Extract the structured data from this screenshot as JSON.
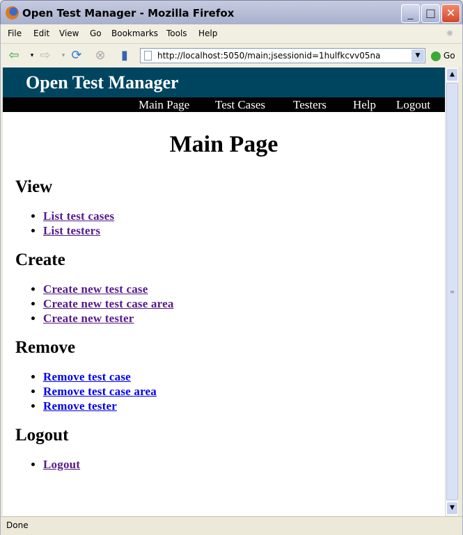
{
  "window": {
    "title": "Open Test Manager - Mozilla Firefox"
  },
  "menu": [
    "File",
    "Edit",
    "View",
    "Go",
    "Bookmarks",
    "Tools",
    "Help"
  ],
  "toolbar": {
    "url": "http://localhost:5050/main;jsessionid=1hulfkcvv05na",
    "go_label": "Go"
  },
  "site": {
    "title": "Open Test Manager",
    "nav": [
      "Main Page",
      "Test Cases",
      "Testers",
      "Help",
      "Logout"
    ]
  },
  "page": {
    "title": "Main Page",
    "sections": [
      {
        "heading": "View",
        "links": [
          "List test cases",
          "List testers"
        ],
        "visited": true
      },
      {
        "heading": "Create",
        "links": [
          "Create new test case",
          "Create new test case area",
          "Create new tester"
        ],
        "visited": true
      },
      {
        "heading": "Remove",
        "links": [
          "Remove test case",
          "Remove test case area",
          "Remove tester"
        ],
        "visited": false
      },
      {
        "heading": "Logout",
        "links": [
          "Logout"
        ],
        "visited": true
      }
    ]
  },
  "colors": {
    "header": "#004560",
    "visited_link": "#551a8b",
    "link": "#0000ee"
  },
  "status": "Done"
}
